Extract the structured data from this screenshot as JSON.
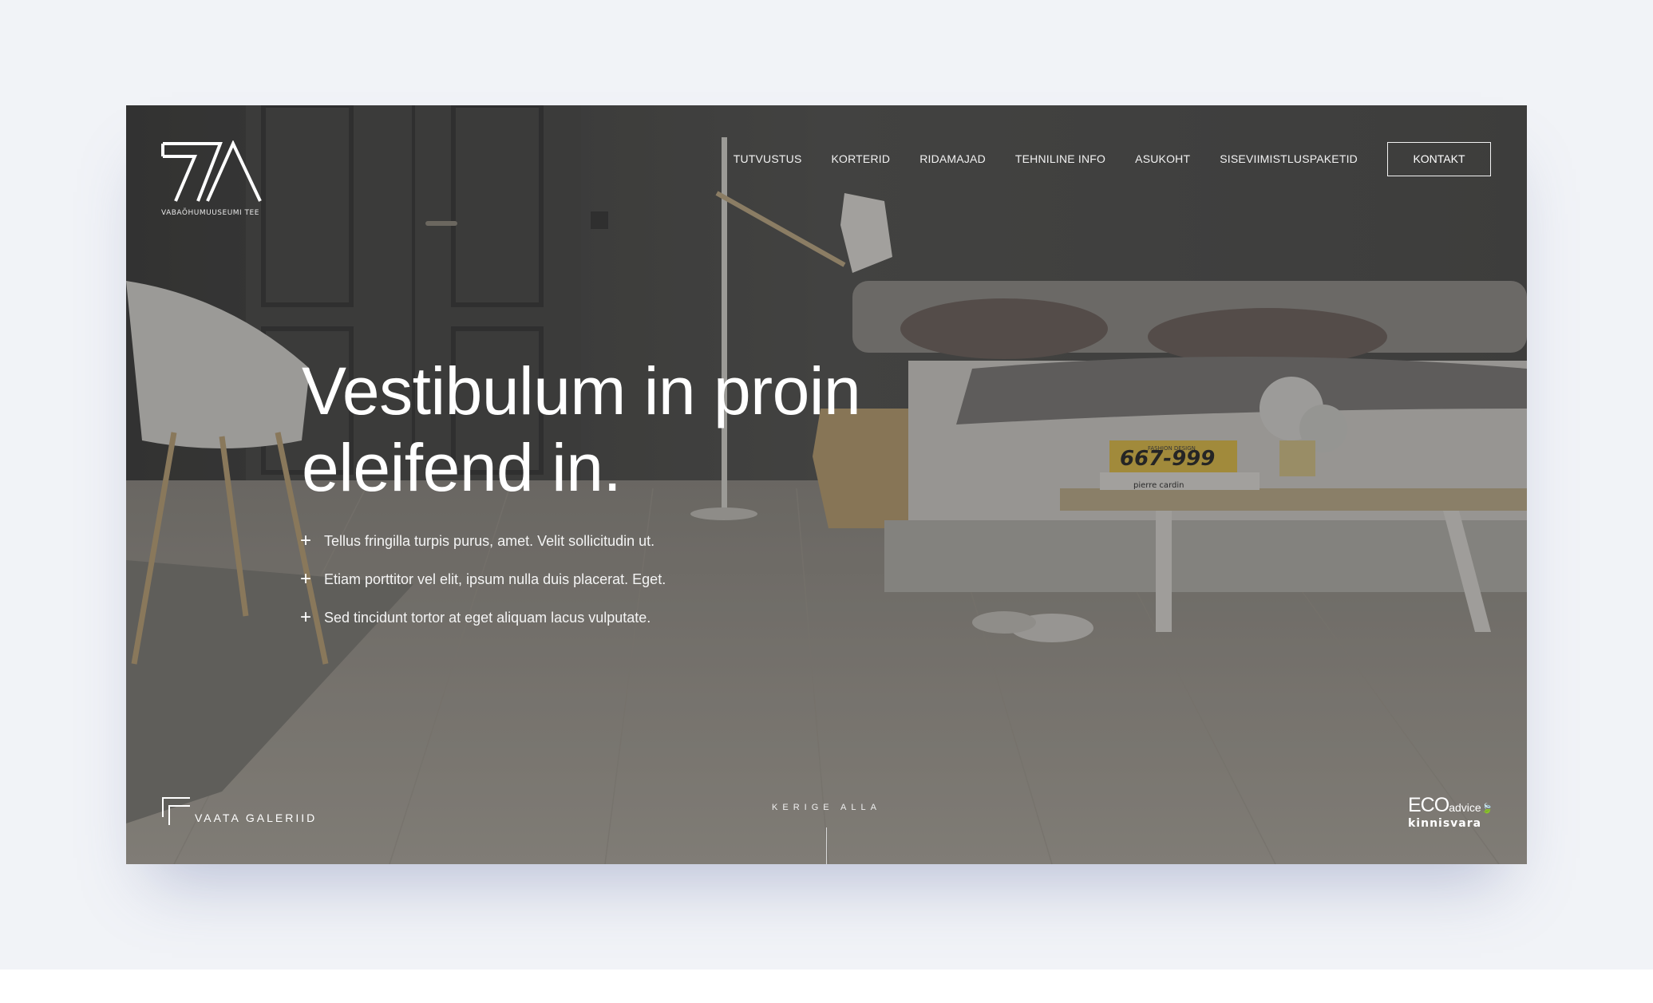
{
  "brand": {
    "logo_caption": "VABAÕHUMUUSEUMI TEE"
  },
  "nav": {
    "items": [
      {
        "label": "TUTVUSTUS"
      },
      {
        "label": "KORTERID"
      },
      {
        "label": "RIDAMAJAD"
      },
      {
        "label": "TEHNILINE INFO"
      },
      {
        "label": "ASUKOHT"
      },
      {
        "label": "SISEVIIMISTLUSPAKETID"
      }
    ],
    "cta_label": "KONTAKT"
  },
  "hero": {
    "headline_line1": "Vestibulum in proin",
    "headline_line2": "eleifend in.",
    "bullets": [
      "Tellus fringilla turpis purus, amet. Velit sollicitudin ut.",
      "Etiam porttitor vel elit, ipsum nulla duis placerat. Eget.",
      "Sed tincidunt tortor at eget aliquam lacus vulputate."
    ],
    "book_label": "667-999",
    "book_sub": "FASHION DESIGN",
    "book_author": "pierre cardin"
  },
  "footer": {
    "gallery_label": "VAATA GALERIID",
    "scroll_label": "KERIGE ALLA",
    "partner_top": "ECO",
    "partner_small": "advice",
    "partner_bottom": "kinnisvara"
  },
  "colors": {
    "page_bg": "#f1f3f7",
    "text": "#ffffff",
    "overlay": "#141414"
  }
}
